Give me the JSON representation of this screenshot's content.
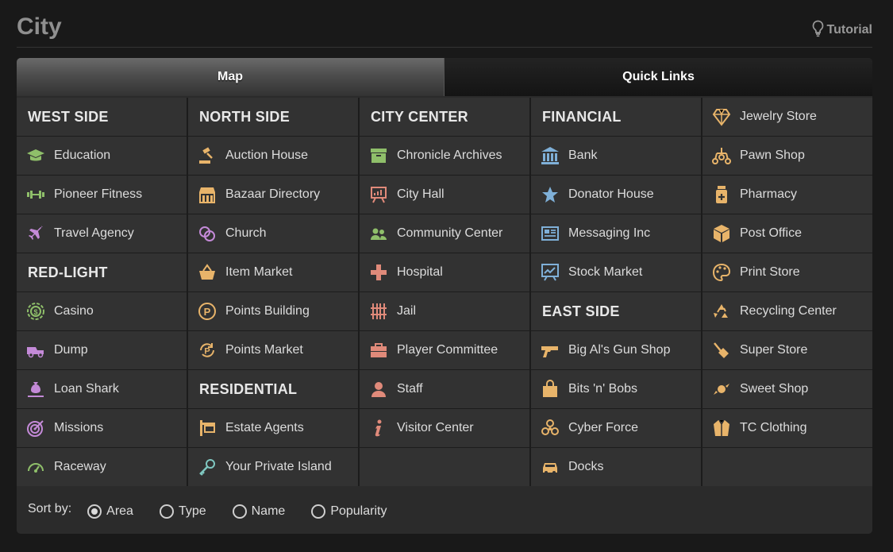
{
  "header": {
    "title": "City",
    "tutorial": "Tutorial"
  },
  "tabs": {
    "map": "Map",
    "quick_links": "Quick Links"
  },
  "columns": [
    {
      "cells": [
        {
          "type": "heading",
          "label": "WEST SIDE"
        },
        {
          "type": "link",
          "label": "Education",
          "icon": "graduation-cap-icon",
          "color": "#8fbf6a"
        },
        {
          "type": "link",
          "label": "Pioneer Fitness",
          "icon": "dumbbell-icon",
          "color": "#8fbf6a"
        },
        {
          "type": "link",
          "label": "Travel Agency",
          "icon": "airplane-icon",
          "color": "#c48ad8"
        },
        {
          "type": "heading",
          "label": "RED-LIGHT"
        },
        {
          "type": "link",
          "label": "Casino",
          "icon": "casino-chip-icon",
          "color": "#8fbf6a"
        },
        {
          "type": "link",
          "label": "Dump",
          "icon": "dump-truck-icon",
          "color": "#c48ad8"
        },
        {
          "type": "link",
          "label": "Loan Shark",
          "icon": "money-bag-hand-icon",
          "color": "#c48ad8"
        },
        {
          "type": "link",
          "label": "Missions",
          "icon": "target-icon",
          "color": "#c48ad8"
        },
        {
          "type": "link",
          "label": "Raceway",
          "icon": "speedometer-icon",
          "color": "#8fbf6a"
        }
      ]
    },
    {
      "cells": [
        {
          "type": "heading",
          "label": "NORTH SIDE"
        },
        {
          "type": "link",
          "label": "Auction House",
          "icon": "gavel-icon",
          "color": "#e8b46a"
        },
        {
          "type": "link",
          "label": "Bazaar Directory",
          "icon": "storefront-icon",
          "color": "#e8b46a"
        },
        {
          "type": "link",
          "label": "Church",
          "icon": "rings-icon",
          "color": "#c48ad8"
        },
        {
          "type": "link",
          "label": "Item Market",
          "icon": "basket-icon",
          "color": "#e8b46a"
        },
        {
          "type": "link",
          "label": "Points Building",
          "icon": "points-coin-icon",
          "color": "#e8b46a"
        },
        {
          "type": "link",
          "label": "Points Market",
          "icon": "points-exchange-icon",
          "color": "#e8b46a"
        },
        {
          "type": "heading",
          "label": "RESIDENTIAL"
        },
        {
          "type": "link",
          "label": "Estate Agents",
          "icon": "sign-post-icon",
          "color": "#e8b46a"
        },
        {
          "type": "link",
          "label": "Your Private Island",
          "icon": "key-icon",
          "color": "#7fc7c0"
        }
      ]
    },
    {
      "cells": [
        {
          "type": "heading",
          "label": "CITY CENTER"
        },
        {
          "type": "link",
          "label": "Chronicle Archives",
          "icon": "archive-box-icon",
          "color": "#8fbf6a"
        },
        {
          "type": "link",
          "label": "City Hall",
          "icon": "chart-board-icon",
          "color": "#e08a7a"
        },
        {
          "type": "link",
          "label": "Community Center",
          "icon": "people-icon",
          "color": "#8fbf6a"
        },
        {
          "type": "link",
          "label": "Hospital",
          "icon": "medical-cross-icon",
          "color": "#e08a7a"
        },
        {
          "type": "link",
          "label": "Jail",
          "icon": "jail-bars-icon",
          "color": "#e08a7a"
        },
        {
          "type": "link",
          "label": "Player Committee",
          "icon": "toolbox-icon",
          "color": "#e08a7a"
        },
        {
          "type": "link",
          "label": "Staff",
          "icon": "person-icon",
          "color": "#e08a7a"
        },
        {
          "type": "link",
          "label": "Visitor Center",
          "icon": "info-icon",
          "color": "#e08a7a"
        },
        {
          "type": "empty"
        }
      ]
    },
    {
      "cells": [
        {
          "type": "heading",
          "label": "FINANCIAL"
        },
        {
          "type": "link",
          "label": "Bank",
          "icon": "bank-icon",
          "color": "#7fb0d8"
        },
        {
          "type": "link",
          "label": "Donator House",
          "icon": "star-icon",
          "color": "#7fb0d8"
        },
        {
          "type": "link",
          "label": "Messaging Inc",
          "icon": "newspaper-icon",
          "color": "#7fb0d8"
        },
        {
          "type": "link",
          "label": "Stock Market",
          "icon": "stock-chart-icon",
          "color": "#7fb0d8"
        },
        {
          "type": "heading",
          "label": "EAST SIDE"
        },
        {
          "type": "link",
          "label": "Big Al's Gun Shop",
          "icon": "gun-icon",
          "color": "#e8b46a"
        },
        {
          "type": "link",
          "label": "Bits 'n' Bobs",
          "icon": "shopping-bag-icon",
          "color": "#e8b46a"
        },
        {
          "type": "link",
          "label": "Cyber Force",
          "icon": "biohazard-icon",
          "color": "#e8b46a"
        },
        {
          "type": "link",
          "label": "Docks",
          "icon": "car-icon",
          "color": "#e8b46a"
        }
      ]
    },
    {
      "cells": [
        {
          "type": "link",
          "label": "Jewelry Store",
          "icon": "diamond-icon",
          "color": "#e8b46a"
        },
        {
          "type": "link",
          "label": "Pawn Shop",
          "icon": "pawn-balls-icon",
          "color": "#e8b46a"
        },
        {
          "type": "link",
          "label": "Pharmacy",
          "icon": "pill-bottle-icon",
          "color": "#e8b46a"
        },
        {
          "type": "link",
          "label": "Post Office",
          "icon": "package-icon",
          "color": "#e8b46a"
        },
        {
          "type": "link",
          "label": "Print Store",
          "icon": "palette-icon",
          "color": "#e8b46a"
        },
        {
          "type": "link",
          "label": "Recycling Center",
          "icon": "recycle-icon",
          "color": "#e8b46a"
        },
        {
          "type": "link",
          "label": "Super Store",
          "icon": "vacuum-icon",
          "color": "#e8b46a"
        },
        {
          "type": "link",
          "label": "Sweet Shop",
          "icon": "candy-icon",
          "color": "#e8b46a"
        },
        {
          "type": "link",
          "label": "TC Clothing",
          "icon": "coat-icon",
          "color": "#e8b46a"
        },
        {
          "type": "empty"
        }
      ]
    }
  ],
  "sort": {
    "label": "Sort by:",
    "options": [
      {
        "label": "Area",
        "checked": true
      },
      {
        "label": "Type",
        "checked": false
      },
      {
        "label": "Name",
        "checked": false
      },
      {
        "label": "Popularity",
        "checked": false
      }
    ]
  }
}
